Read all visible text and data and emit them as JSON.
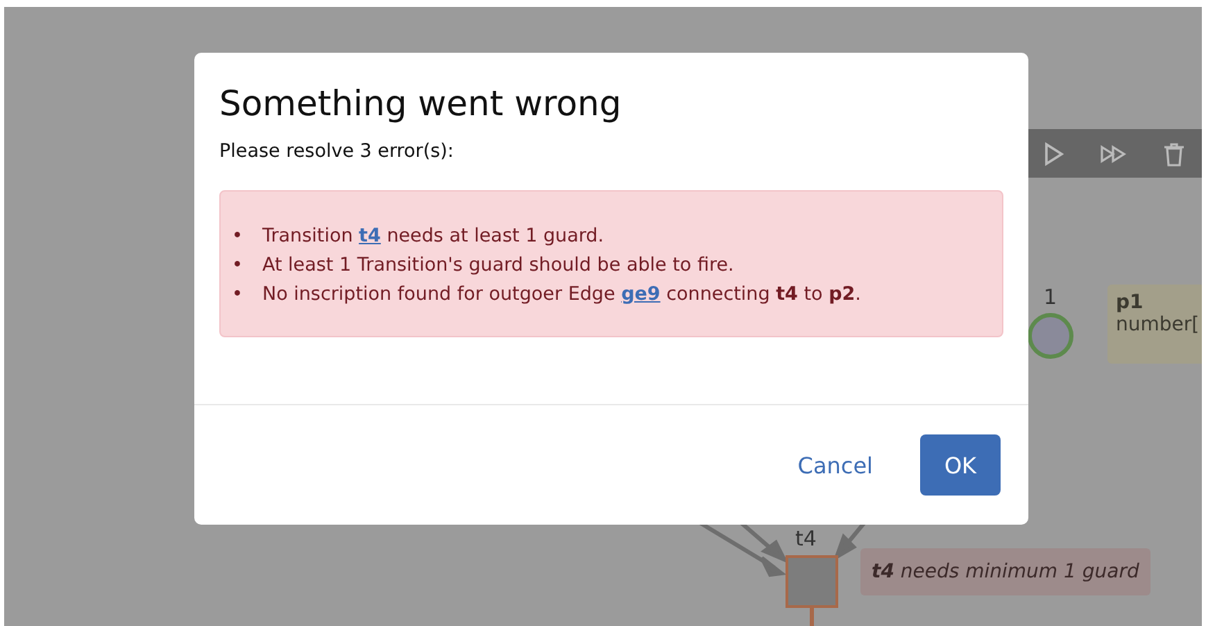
{
  "canvas": {
    "toolbar": {
      "buttons": [
        {
          "kind": "play"
        },
        {
          "kind": "fast-forward"
        },
        {
          "kind": "delete"
        }
      ]
    },
    "place": {
      "tokens": "1",
      "name": "p1",
      "type": "number["
    },
    "transition": {
      "name": "t4",
      "warning_subject": "t4",
      "warning": "needs minimum 1 guard"
    }
  },
  "dialog": {
    "title": "Something went wrong",
    "message": "Please resolve 3 error(s):",
    "marker": "•",
    "errors": [
      [
        {
          "kind": "text",
          "text": "Transition "
        },
        {
          "kind": "link",
          "text": "t4"
        },
        {
          "kind": "text",
          "text": " needs at least 1 guard."
        }
      ],
      [
        {
          "kind": "text",
          "text": "At least 1 Transition's guard should be able to fire."
        }
      ],
      [
        {
          "kind": "text",
          "text": "No inscription found for outgoer Edge "
        },
        {
          "kind": "link",
          "text": "ge9"
        },
        {
          "kind": "text",
          "text": " connecting "
        },
        {
          "kind": "bold",
          "text": "t4"
        },
        {
          "kind": "text",
          "text": " to "
        },
        {
          "kind": "bold",
          "text": "p2"
        },
        {
          "kind": "text",
          "text": "."
        }
      ]
    ],
    "buttons": [
      {
        "label": "Cancel",
        "kind": "secondary"
      },
      {
        "label": "OK",
        "kind": "primary"
      }
    ]
  }
}
